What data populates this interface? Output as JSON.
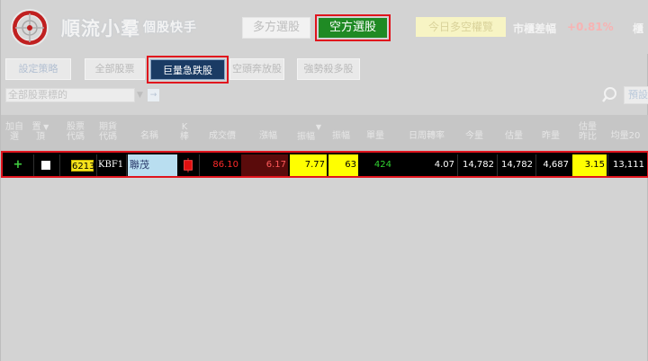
{
  "header": {
    "app_title": "順流小羣",
    "app_subtitle": "個股快手",
    "mode_long_label": "多方選股",
    "mode_short_label": "空方選股",
    "overview_label": "今日多空權覽",
    "diff_label": "市櫃差幅",
    "diff_value": "+0.81%",
    "header_cut_label": "櫃"
  },
  "tabs": {
    "settings": "設定策略",
    "all": "全部股票",
    "active": "巨量急跌股",
    "bear": "空頭奔放股",
    "weak": "強勢殺多股"
  },
  "filter": {
    "value": "全部股票標的",
    "go_label": "→",
    "preset_label": "預設"
  },
  "columns": {
    "add": [
      "加自",
      "選"
    ],
    "top": [
      "置",
      "頂"
    ],
    "code": [
      "股票",
      "代碼"
    ],
    "fut": [
      "期貨",
      "代碼"
    ],
    "name": "名稱",
    "k": [
      "K",
      "棒"
    ],
    "price": "成交價",
    "chg": "漲幅",
    "amp": "振幅",
    "ampv": "振幅",
    "vol": "單量",
    "turn": "日周轉率",
    "today": "今量",
    "est": "估量",
    "yday": "昨量",
    "ratio": [
      "估量",
      "昨比"
    ],
    "avg20": "均量20"
  },
  "row": {
    "add": "+",
    "code": "6213",
    "fut": "KBF1",
    "name": "聯茂",
    "price": "86.10",
    "chg": "6.17",
    "amp": "7.77",
    "ampv": "63",
    "vol": "424",
    "turn": "4.07",
    "today": "14,782",
    "est": "14,782",
    "yday": "4,687",
    "ratio": "3.15",
    "avg20": "13,111"
  },
  "colors": {
    "accent_red": "#e0141d",
    "short_green": "#1f8a24",
    "active_tab": "#1a3b64",
    "highlight_yellow": "#ffff00"
  }
}
